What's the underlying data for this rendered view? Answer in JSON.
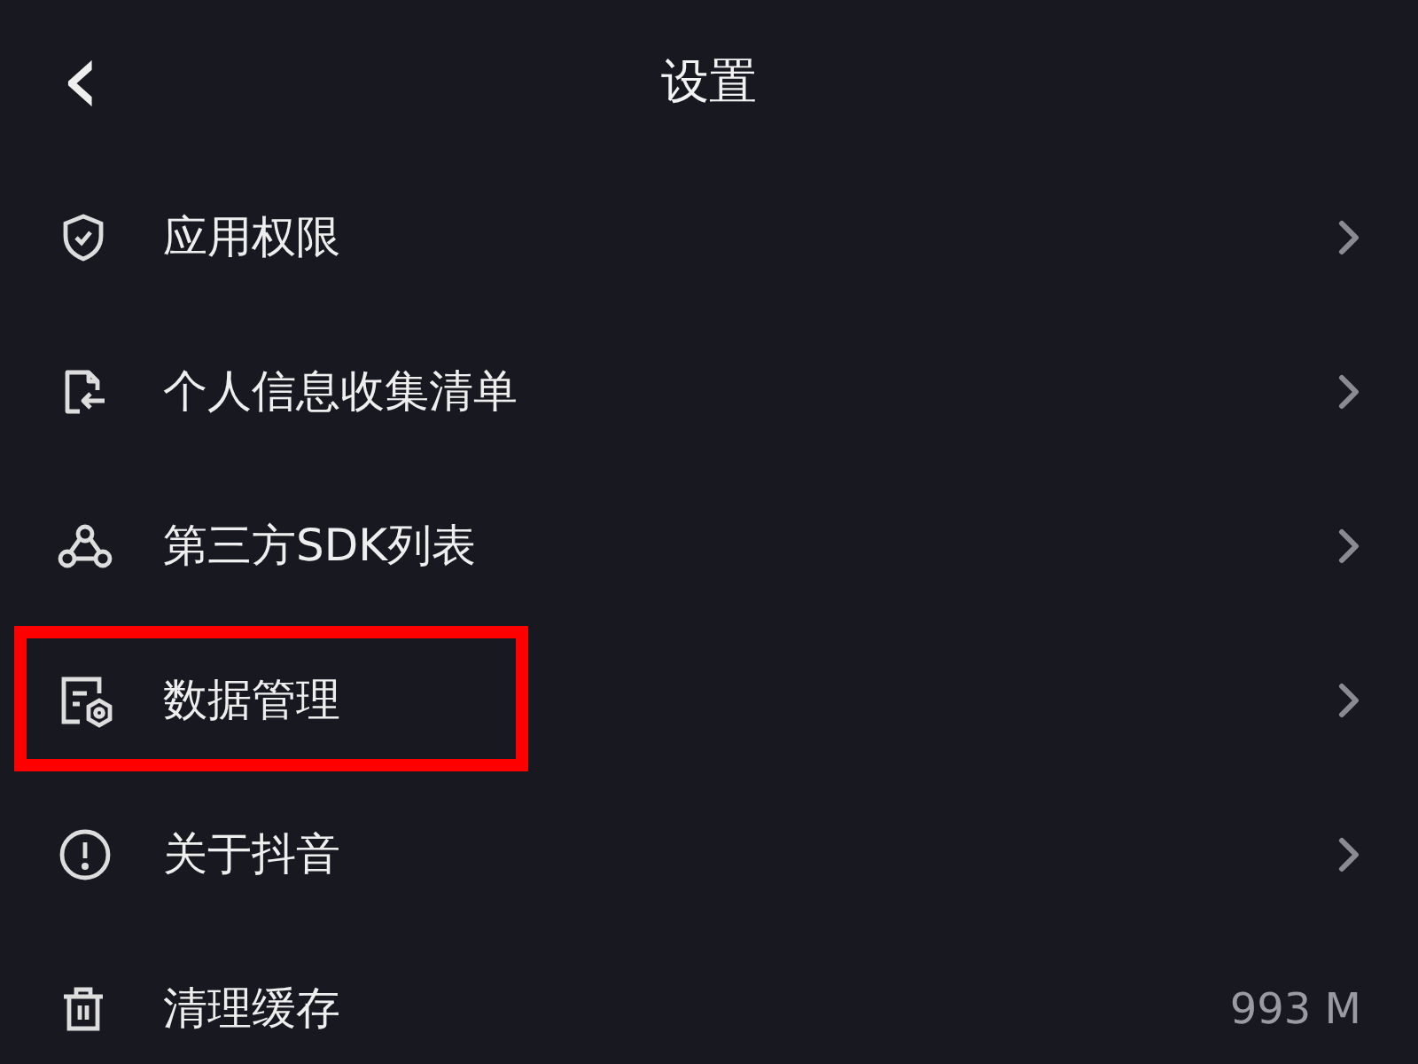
{
  "header": {
    "back": "‹",
    "title": "设置"
  },
  "items": [
    {
      "label": "应用权限",
      "kind": "link",
      "highlighted": false
    },
    {
      "label": "个人信息收集清单",
      "kind": "link",
      "highlighted": false
    },
    {
      "label": "第三方SDK列表",
      "kind": "link",
      "highlighted": false
    },
    {
      "label": "数据管理",
      "kind": "link",
      "highlighted": true
    },
    {
      "label": "关于抖音",
      "kind": "link",
      "highlighted": false
    },
    {
      "label": "清理缓存",
      "kind": "value",
      "value": "993 M",
      "highlighted": false
    }
  ]
}
